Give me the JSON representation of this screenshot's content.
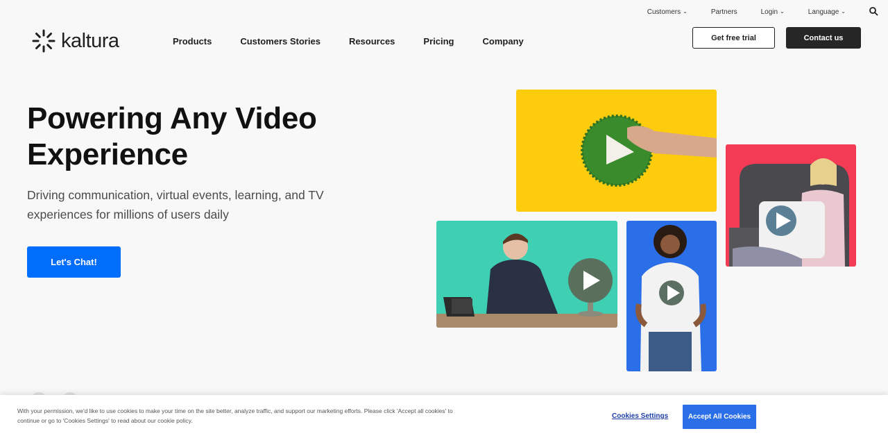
{
  "utility_nav": {
    "items": [
      {
        "label": "Customers",
        "has_dropdown": true
      },
      {
        "label": "Partners",
        "has_dropdown": false
      },
      {
        "label": "Login",
        "has_dropdown": true
      },
      {
        "label": "Language",
        "has_dropdown": true
      }
    ],
    "search_icon": "search-icon"
  },
  "header": {
    "logo_text": "kaltura",
    "nav": [
      "Products",
      "Customers Stories",
      "Resources",
      "Pricing",
      "Company"
    ],
    "trial_label": "Get free trial",
    "contact_label": "Contact us"
  },
  "hero": {
    "title_line1": "Powering Any Video",
    "title_line2": "Experience",
    "subtitle_line1": "Driving communication, virtual events, learning, and TV",
    "subtitle_line2": "experiences for millions of users daily",
    "cta_label": "Let's Chat!"
  },
  "cookie_banner": {
    "text_line1": "With your permission, we'd like to use cookies to make your time on the site better, analyze traffic, and support our marketing efforts. Please click 'Accept all cookies' to",
    "text_line2": "continue or go to 'Cookies Settings' to read about our cookie policy.",
    "settings_label": "Cookies Settings",
    "accept_label": "Accept All Cookies"
  },
  "colors": {
    "primary_blue": "#006efa",
    "dark_button": "#262626",
    "tile_yellow": "#fdcc0d",
    "tile_red": "#f43b55",
    "tile_teal": "#3fd0b4",
    "tile_blue": "#2a6ee8"
  }
}
